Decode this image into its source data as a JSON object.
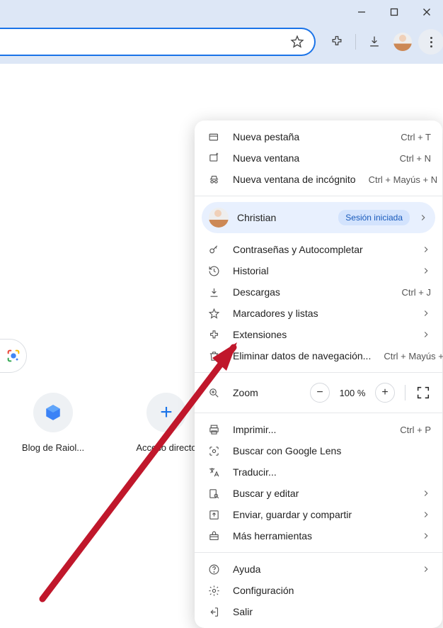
{
  "window": {
    "minimize": "—",
    "maximize": "◻",
    "close": "✕"
  },
  "toolbar": {
    "star": "star-icon",
    "extensions": "puzzle-icon",
    "downloads": "download-icon",
    "more": "more-icon"
  },
  "menu": {
    "newTab": {
      "label": "Nueva pestaña",
      "shortcut": "Ctrl + T"
    },
    "newWindow": {
      "label": "Nueva ventana",
      "shortcut": "Ctrl + N"
    },
    "newIncognito": {
      "label": "Nueva ventana de incógnito",
      "shortcut": "Ctrl + Mayús + N"
    },
    "profile": {
      "name": "Christian",
      "badge": "Sesión iniciada"
    },
    "passwords": "Contraseñas y Autocompletar",
    "history": "Historial",
    "downloads": {
      "label": "Descargas",
      "shortcut": "Ctrl + J"
    },
    "bookmarks": "Marcadores y listas",
    "extensions": "Extensiones",
    "clearData": {
      "label": "Eliminar datos de navegación...",
      "shortcut": "Ctrl + Mayús + Supr"
    },
    "zoom": {
      "label": "Zoom",
      "value": "100 %"
    },
    "print": {
      "label": "Imprimir...",
      "shortcut": "Ctrl + P"
    },
    "lens": "Buscar con Google Lens",
    "translate": "Traducir...",
    "findEdit": "Buscar y editar",
    "castSave": "Enviar, guardar y compartir",
    "moreTools": "Más herramientas",
    "help": "Ayuda",
    "settings": "Configuración",
    "exit": "Salir"
  },
  "shortcuts": {
    "raiola": "Blog de Raiol...",
    "add": "Acceso directo"
  }
}
